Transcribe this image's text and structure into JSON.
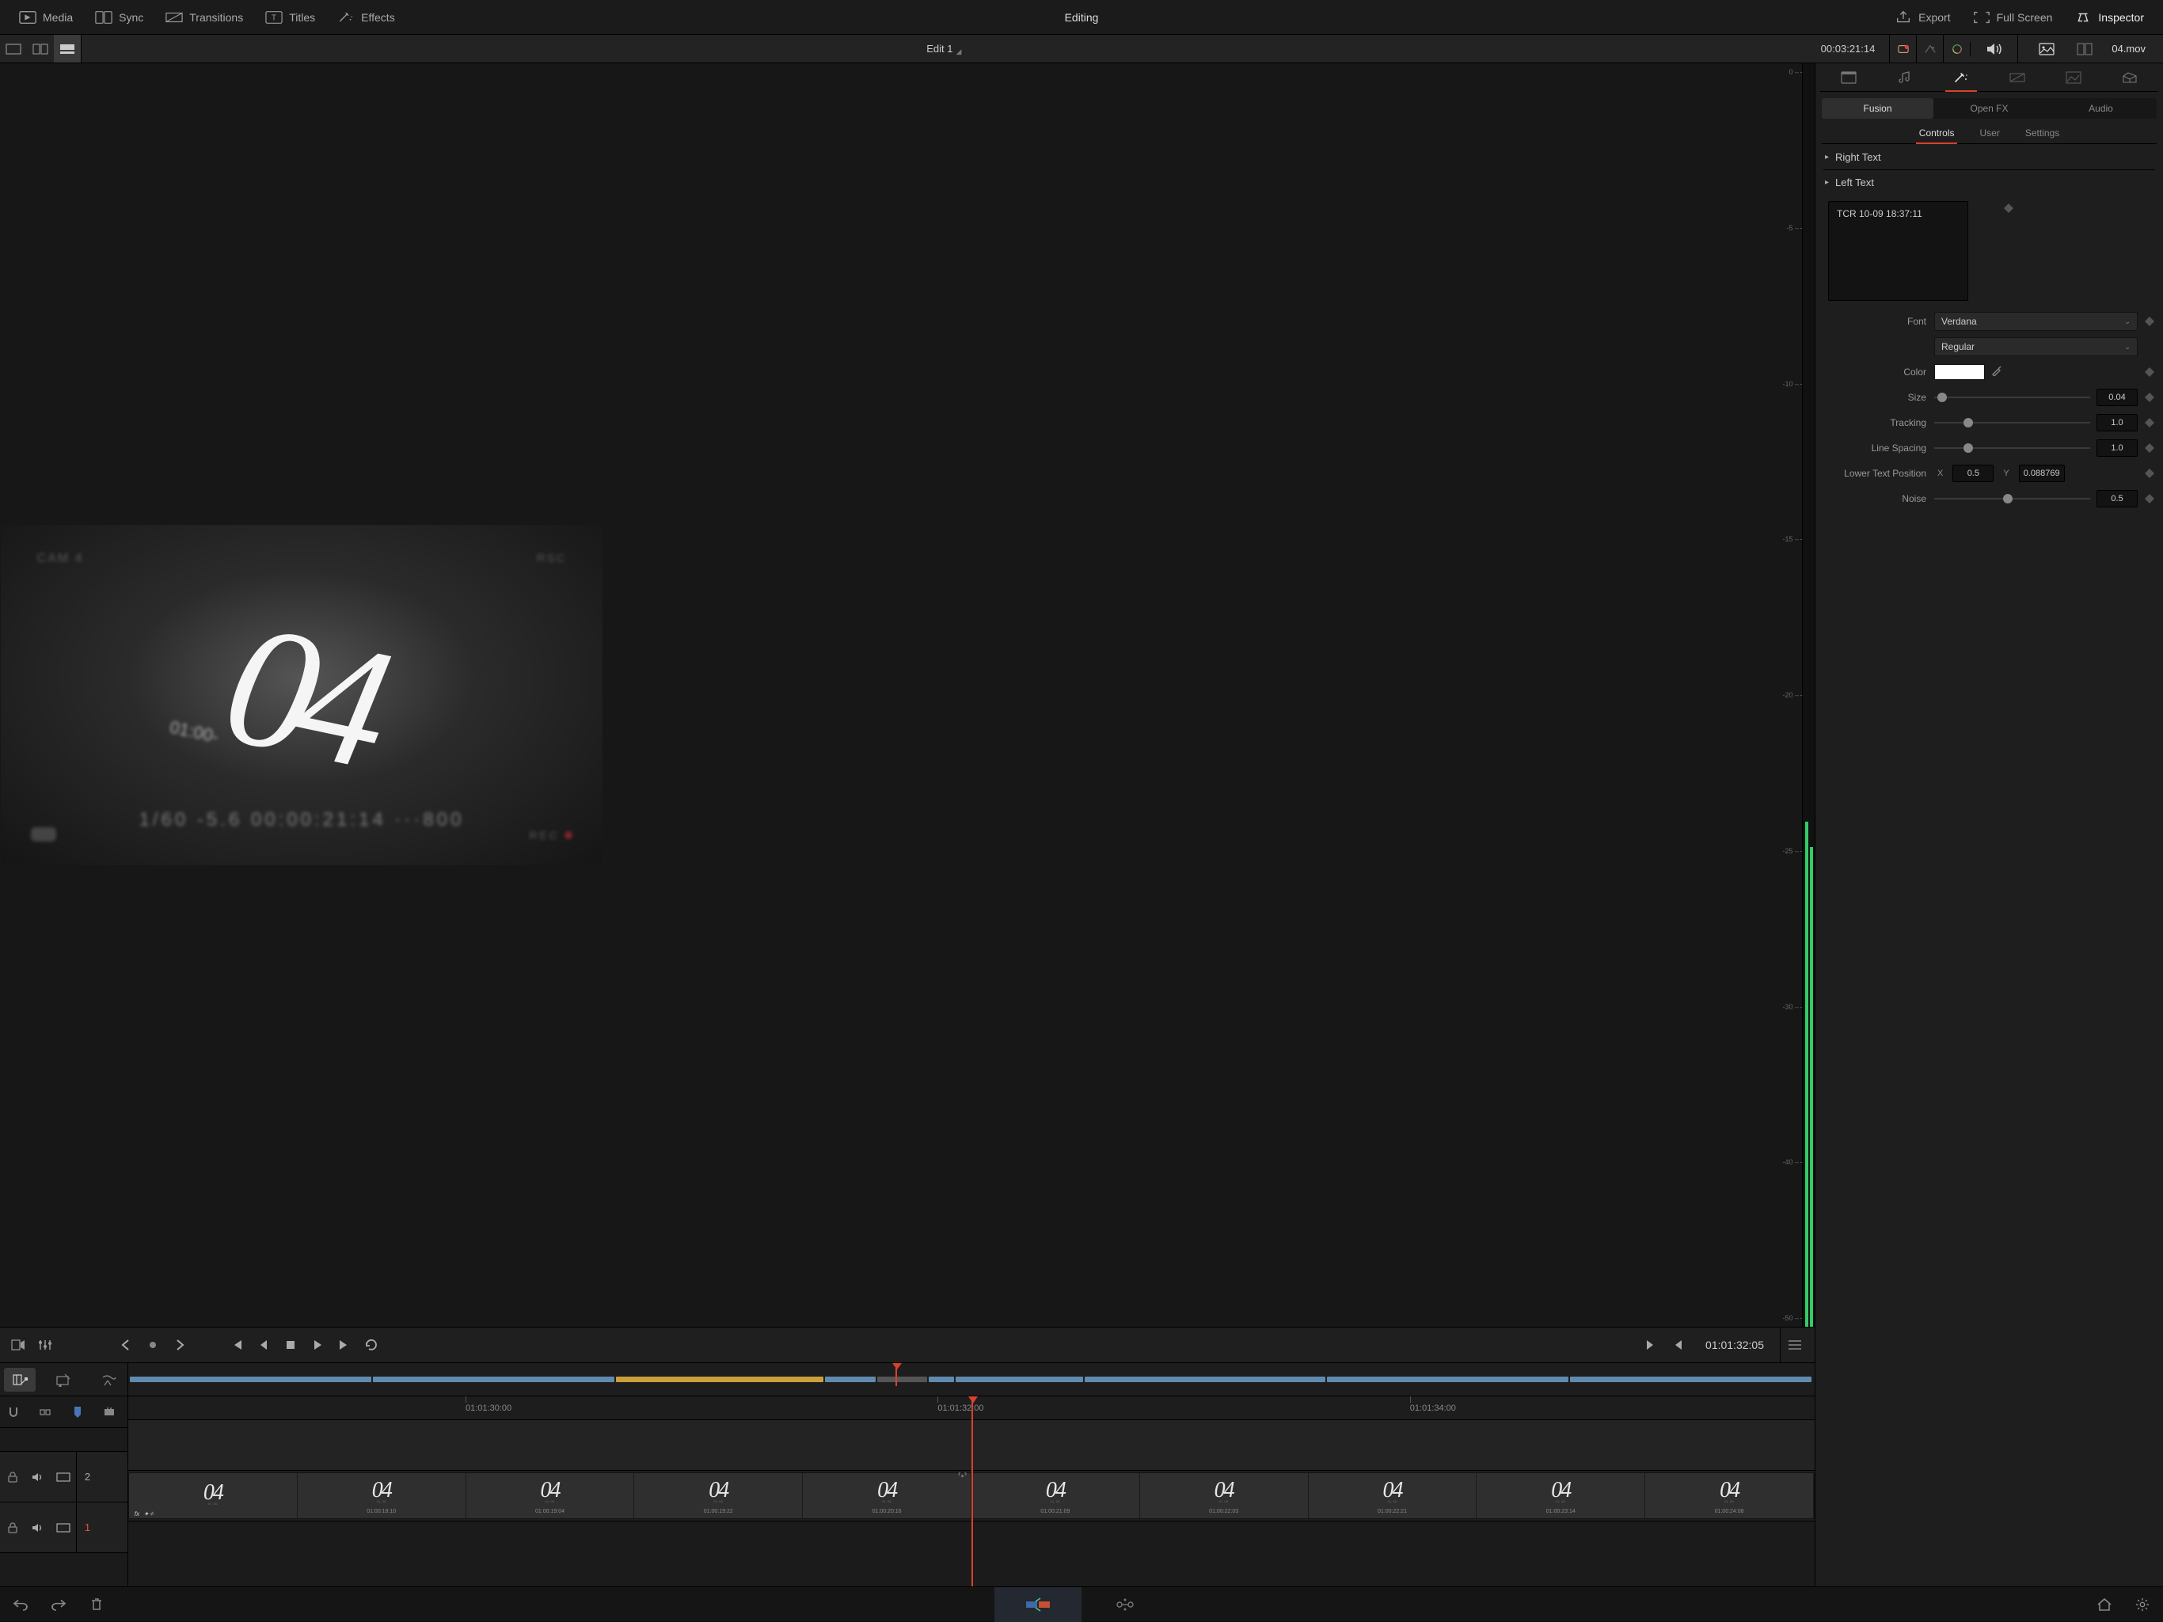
{
  "menubar": {
    "media": "Media",
    "sync": "Sync",
    "transitions": "Transitions",
    "titles": "Titles",
    "effects": "Effects",
    "center_title": "Editing",
    "export": "Export",
    "fullscreen": "Full Screen",
    "inspector": "Inspector"
  },
  "viewer": {
    "timeline_name": "Edit 1",
    "source_timecode": "00:03:21:14",
    "clip_name": "04.mov",
    "slate_number": "04",
    "slate_mini_tc": "01:00-",
    "slate_cam": "CAM 4",
    "slate_rec_top": "RSC",
    "slate_rec": "REC",
    "burnin_line": "1/60    -5.6    00:00:21:14    ···800"
  },
  "audio_scale": [
    "0 –",
    "-5 –",
    "-10 –",
    "-15 –",
    "-20 –",
    "-25 –",
    "-30 –",
    "-40 –",
    "-50 –"
  ],
  "transport": {
    "record_timecode": "01:01:32:05"
  },
  "ruler": {
    "ticks": [
      {
        "label": "01:01:30:00",
        "pos_pct": 20
      },
      {
        "label": "01:01:32:00",
        "pos_pct": 48
      },
      {
        "label": "01:01:34:00",
        "pos_pct": 76
      }
    ],
    "playhead_pct": 50
  },
  "strip": {
    "segments": [
      {
        "w": 14.4,
        "cls": ""
      },
      {
        "w": 14.4,
        "cls": ""
      },
      {
        "w": 12.4,
        "cls": "gold"
      },
      {
        "w": 3.0,
        "cls": ""
      },
      {
        "w": 3.0,
        "cls": "gap"
      },
      {
        "w": 1.5,
        "cls": ""
      },
      {
        "w": 7.6,
        "cls": ""
      },
      {
        "w": 14.4,
        "cls": ""
      },
      {
        "w": 14.4,
        "cls": ""
      },
      {
        "w": 14.4,
        "cls": ""
      }
    ],
    "playhead_pct": 45.5
  },
  "tracks": {
    "v2_num": "2",
    "v1_num": "1",
    "clip_label": "04",
    "clip_sub": "º¹ ºº",
    "thumbs": [
      {
        "tc": ""
      },
      {
        "tc": "01:00:18:10"
      },
      {
        "tc": "01:00:19:04"
      },
      {
        "tc": "01:00:19:22"
      },
      {
        "tc": "01:00:20:16"
      },
      {
        "tc": "01:00:21:09"
      },
      {
        "tc": "01:00:22:03"
      },
      {
        "tc": "01:00:22:21"
      },
      {
        "tc": "01:00:23:14"
      },
      {
        "tc": "01:00:24:08"
      }
    ]
  },
  "inspector": {
    "subtabs": {
      "fusion": "Fusion",
      "openfx": "Open FX",
      "audio": "Audio"
    },
    "minitabs": {
      "controls": "Controls",
      "user": "User",
      "settings": "Settings"
    },
    "disclosures": {
      "right_text": "Right Text",
      "left_text": "Left Text"
    },
    "text_value": "TCR 10-09 18:37:11",
    "labels": {
      "font": "Font",
      "color": "Color",
      "size": "Size",
      "tracking": "Tracking",
      "line_spacing": "Line Spacing",
      "lower_text_position": "Lower Text Position",
      "noise": "Noise",
      "x": "X",
      "y": "Y"
    },
    "font_family": "Verdana",
    "font_style": "Regular",
    "color_hex": "#ffffff",
    "size": "0.04",
    "size_pos_pct": 5,
    "tracking": "1.0",
    "tracking_pos_pct": 22,
    "line_spacing": "1.0",
    "line_spacing_pos_pct": 22,
    "lower_x": "0.5",
    "lower_y": "0.088769",
    "noise": "0.5",
    "noise_pos_pct": 47
  }
}
